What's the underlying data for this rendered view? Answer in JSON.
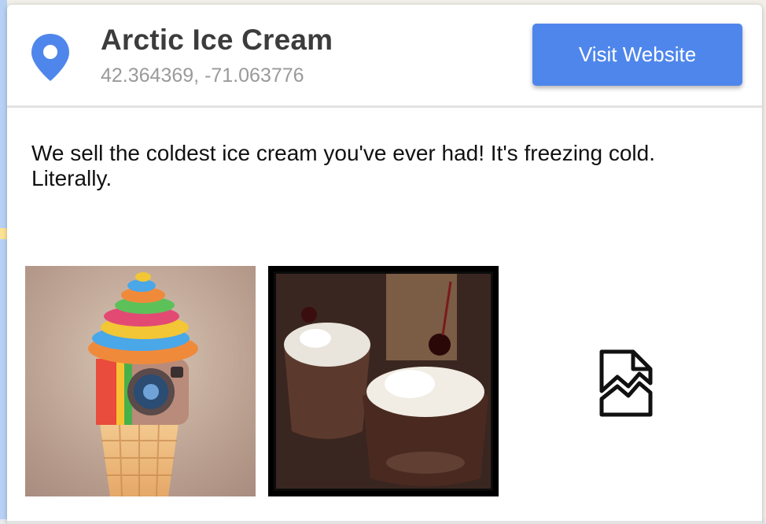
{
  "place": {
    "name": "Arctic Ice Cream",
    "coordinates": "42.364369, -71.063776",
    "description": "We sell the coldest ice cream you've ever had! It's freezing cold. Literally."
  },
  "actions": {
    "visit_label": "Visit Website"
  },
  "icons": {
    "pin": "location-pin-icon",
    "broken": "broken-image-icon"
  },
  "colors": {
    "accent": "#4f86ec",
    "pin": "#4f86ec",
    "title": "#3c3c3c",
    "coords": "#9a9a9a"
  },
  "photos": [
    {
      "subject": "rainbow soft-serve camera cone"
    },
    {
      "subject": "ice cream sundaes with cherries"
    },
    {
      "subject": "broken image"
    }
  ]
}
